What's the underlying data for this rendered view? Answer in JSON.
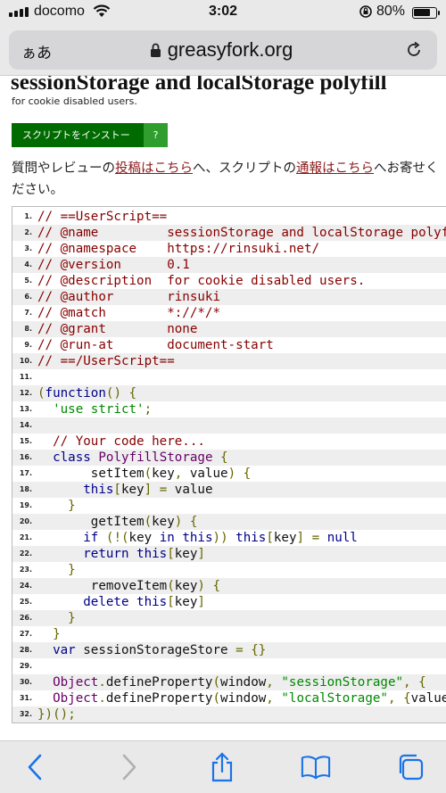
{
  "status_bar": {
    "carrier": "docomo",
    "time": "3:02",
    "battery": "80%",
    "battery_level": 0.8
  },
  "browser": {
    "text_size_label": "ぁあ",
    "domain": "greasyfork.org"
  },
  "script": {
    "title": "sessionStorage and localStorage polyfill",
    "description": "for cookie disabled users.",
    "install_label": "スクリプトをインストール",
    "install_help": "?"
  },
  "feedback": {
    "part1": "質問やレビューの",
    "link1": "投稿はこちら",
    "part2": "へ、スクリプトの",
    "link2": "通報はこちら",
    "part3": "へお寄せください。"
  },
  "code_lines": [
    "// ==UserScript==",
    "// @name         sessionStorage and localStorage polyfill",
    "// @namespace    https://rinsuki.net/",
    "// @version      0.1",
    "// @description  for cookie disabled users.",
    "// @author       rinsuki",
    "// @match        *://*/*",
    "// @grant        none",
    "// @run-at       document-start",
    "// ==/UserScript==",
    "",
    "(function() {",
    "  'use strict';",
    "",
    "  // Your code here...",
    "  class PolyfillStorage {",
    "       setItem(key, value) {",
    "      this[key] = value",
    "    }",
    "       getItem(key) {",
    "      if (!(key in this)) this[key] = null",
    "      return this[key]",
    "    }",
    "       removeItem(key) {",
    "      delete this[key]",
    "    }",
    "  }",
    "  var sessionStorageStore = {}",
    "",
    "  Object.defineProperty(window, \"sessionStorage\", {",
    "  Object.defineProperty(window, \"localStorage\", {value",
    "})();"
  ]
}
